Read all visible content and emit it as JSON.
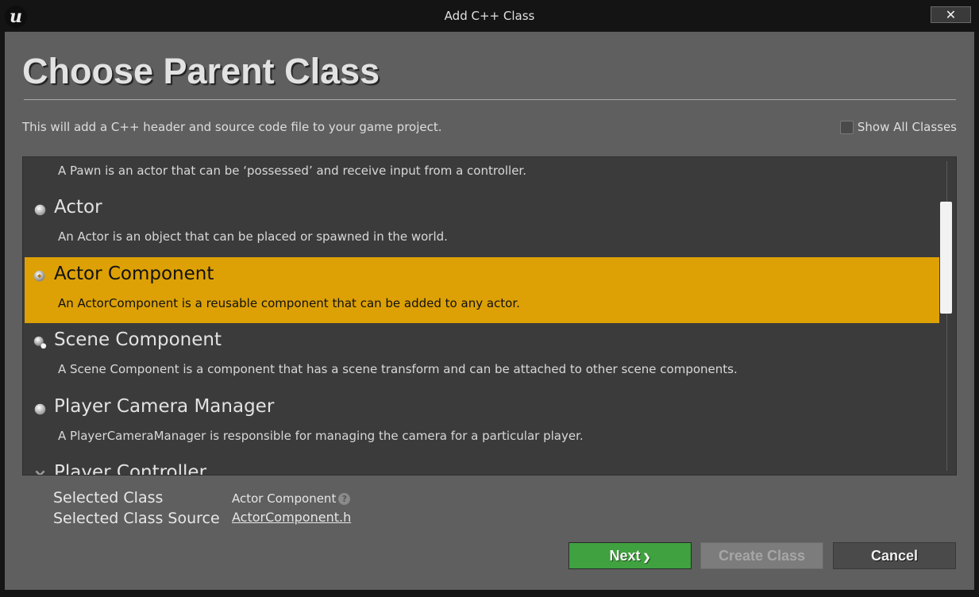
{
  "window": {
    "title": "Add C++ Class",
    "logo_letter": "u",
    "close_glyph": "✕"
  },
  "header": {
    "title": "Choose Parent Class",
    "description": "This will add a C++ header and source code file to your game project.",
    "show_all_label": "Show All Classes",
    "show_all_checked": false
  },
  "class_list": {
    "items": [
      {
        "name": "",
        "description": "A Pawn is an actor that can be ‘possessed’ and receive input from a controller.",
        "icon": "pawn-icon",
        "selected": false
      },
      {
        "name": "Actor",
        "description": "An Actor is an object that can be placed or spawned in the world.",
        "icon": "actor-sphere-icon",
        "selected": false
      },
      {
        "name": "Actor Component",
        "description": "An ActorComponent is a reusable component that can be added to any actor.",
        "icon": "actor-component-icon",
        "selected": true
      },
      {
        "name": "Scene Component",
        "description": "A Scene Component is a component that has a scene transform and can be attached to other scene components.",
        "icon": "scene-component-icon",
        "selected": false
      },
      {
        "name": "Player Camera Manager",
        "description": "A PlayerCameraManager is responsible for managing the camera for a particular player.",
        "icon": "camera-manager-icon",
        "selected": false
      },
      {
        "name": "Player Controller",
        "description": "",
        "icon": "player-controller-icon",
        "selected": false
      }
    ]
  },
  "selection": {
    "class_label": "Selected Class",
    "class_value": "Actor Component",
    "source_label": "Selected Class Source",
    "source_value": "ActorComponent.h"
  },
  "buttons": {
    "next": "Next",
    "create": "Create Class",
    "cancel": "Cancel"
  },
  "colors": {
    "selected_row": "#dda106",
    "next_button": "#3fa13f",
    "panel": "#5f5f5f",
    "list_bg": "#3b3b3b"
  }
}
